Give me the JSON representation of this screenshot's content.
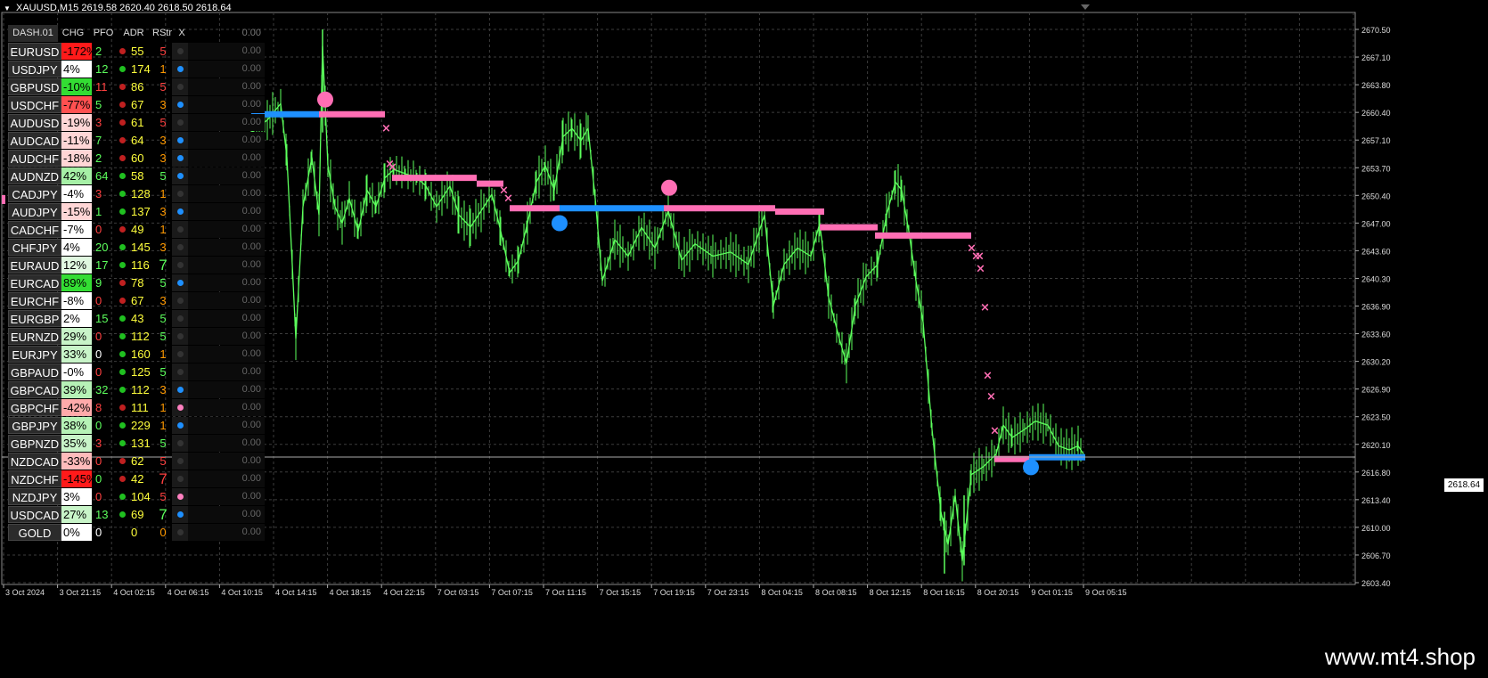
{
  "chart": {
    "symbol_title": "XAUUSD,M15",
    "ohlc": "2619.58 2620.40 2618.50 2618.64",
    "current_price": "2618.64",
    "price_labels": [
      "2670.50",
      "2667.10",
      "2663.80",
      "2660.40",
      "2657.10",
      "2653.70",
      "2650.40",
      "2647.00",
      "2643.60",
      "2640.30",
      "2636.90",
      "2633.60",
      "2630.20",
      "2626.90",
      "2623.50",
      "2620.10",
      "2616.80",
      "2613.40",
      "2610.00",
      "2606.70",
      "2603.40"
    ],
    "time_labels": [
      "3 Oct 2024",
      "3 Oct 21:15",
      "4 Oct 02:15",
      "4 Oct 06:15",
      "4 Oct 10:15",
      "4 Oct 14:15",
      "4 Oct 18:15",
      "4 Oct 22:15",
      "7 Oct 03:15",
      "7 Oct 07:15",
      "7 Oct 11:15",
      "7 Oct 15:15",
      "7 Oct 19:15",
      "7 Oct 23:15",
      "8 Oct 04:15",
      "8 Oct 08:15",
      "8 Oct 12:15",
      "8 Oct 16:15",
      "8 Oct 20:15",
      "9 Oct 01:15",
      "9 Oct 05:15"
    ],
    "colors": {
      "candle": "#5cff5c",
      "grid": "#3c3c3c",
      "pink": "#ff6eb4",
      "blue": "#1e90ff"
    }
  },
  "dashboard": {
    "title": "DASH.01",
    "headers": [
      "CHG",
      "PFO",
      "ADR",
      "RStr",
      "X"
    ],
    "header_value": "0.00",
    "rows": [
      {
        "name": "EURUSD",
        "chg": "-172%",
        "chg_bg": "#ff1a1a",
        "pfo": "2",
        "pfo_color": "#5cff5c",
        "dot": "#c02020",
        "adr": "55",
        "rstr": "5",
        "rstr_color": "#ff4040",
        "dot2": "#333333",
        "value": "0.00"
      },
      {
        "name": "USDJPY",
        "chg": "4%",
        "chg_bg": "#ffffff",
        "pfo": "12",
        "pfo_color": "#5cff5c",
        "dot": "#20c020",
        "adr": "174",
        "rstr": "1",
        "rstr_color": "#ff9900",
        "dot2": "#1e90ff",
        "value": "0.00"
      },
      {
        "name": "GBPUSD",
        "chg": "-10%",
        "chg_bg": "#33dd33",
        "pfo": "11",
        "pfo_color": "#ff4040",
        "dot": "#c02020",
        "adr": "86",
        "rstr": "5",
        "rstr_color": "#ff4040",
        "dot2": "#333333",
        "value": "0.00"
      },
      {
        "name": "USDCHF",
        "chg": "-77%",
        "chg_bg": "#ff5050",
        "pfo": "5",
        "pfo_color": "#5cff5c",
        "dot": "#c02020",
        "adr": "67",
        "rstr": "3",
        "rstr_color": "#ff9900",
        "dot2": "#1e90ff",
        "value": "0.00"
      },
      {
        "name": "AUDUSD",
        "chg": "-19%",
        "chg_bg": "#ffd6d6",
        "pfo": "3",
        "pfo_color": "#ff4040",
        "dot": "#c02020",
        "adr": "61",
        "rstr": "5",
        "rstr_color": "#ff4040",
        "dot2": "#333333",
        "value": "0.00"
      },
      {
        "name": "AUDCAD",
        "chg": "-11%",
        "chg_bg": "#ffd6d6",
        "pfo": "7",
        "pfo_color": "#5cff5c",
        "dot": "#c02020",
        "adr": "64",
        "rstr": "3",
        "rstr_color": "#ff9900",
        "dot2": "#1e90ff",
        "value": "0.00"
      },
      {
        "name": "AUDCHF",
        "chg": "-18%",
        "chg_bg": "#ffd6d6",
        "pfo": "2",
        "pfo_color": "#5cff5c",
        "dot": "#c02020",
        "adr": "60",
        "rstr": "3",
        "rstr_color": "#ff9900",
        "dot2": "#1e90ff",
        "value": "0.00"
      },
      {
        "name": "AUDNZD",
        "chg": "42%",
        "chg_bg": "#a6f0a6",
        "pfo": "64",
        "pfo_color": "#5cff5c",
        "dot": "#20c020",
        "adr": "58",
        "rstr": "5",
        "rstr_color": "#5cff5c",
        "dot2": "#1e90ff",
        "value": "0.00"
      },
      {
        "name": "CADJPY",
        "chg": "-4%",
        "chg_bg": "#ffffff",
        "pfo": "3",
        "pfo_color": "#ff4040",
        "dot": "#20c020",
        "adr": "128",
        "rstr": "1",
        "rstr_color": "#ff9900",
        "dot2": "#333333",
        "value": "0.00"
      },
      {
        "name": "AUDJPY",
        "chg": "-15%",
        "chg_bg": "#ffd6d6",
        "pfo": "1",
        "pfo_color": "#5cff5c",
        "dot": "#20c020",
        "adr": "137",
        "rstr": "3",
        "rstr_color": "#ff9900",
        "dot2": "#1e90ff",
        "value": "0.00"
      },
      {
        "name": "CADCHF",
        "chg": "-7%",
        "chg_bg": "#ffffff",
        "pfo": "0",
        "pfo_color": "#ff4040",
        "dot": "#c02020",
        "adr": "49",
        "rstr": "1",
        "rstr_color": "#ff9900",
        "dot2": "#333333",
        "value": "0.00"
      },
      {
        "name": "CHFJPY",
        "chg": "4%",
        "chg_bg": "#ffffff",
        "pfo": "20",
        "pfo_color": "#5cff5c",
        "dot": "#20c020",
        "adr": "145",
        "rstr": "3",
        "rstr_color": "#ff9900",
        "dot2": "#333333",
        "value": "0.00"
      },
      {
        "name": "EURAUD",
        "chg": "12%",
        "chg_bg": "#e0f8e0",
        "pfo": "17",
        "pfo_color": "#5cff5c",
        "dot": "#20c020",
        "adr": "116",
        "rstr": "7",
        "rstr_color": "#5cff5c",
        "dot2": "#333333",
        "value": "0.00"
      },
      {
        "name": "EURCAD",
        "chg": "89%",
        "chg_bg": "#33dd33",
        "pfo": "9",
        "pfo_color": "#5cff5c",
        "dot": "#c02020",
        "adr": "78",
        "rstr": "5",
        "rstr_color": "#5cff5c",
        "dot2": "#1e90ff",
        "value": "0.00"
      },
      {
        "name": "EURCHF",
        "chg": "-8%",
        "chg_bg": "#ffffff",
        "pfo": "0",
        "pfo_color": "#ff4040",
        "dot": "#c02020",
        "adr": "67",
        "rstr": "3",
        "rstr_color": "#ff9900",
        "dot2": "#333333",
        "value": "0.00"
      },
      {
        "name": "EURGBP",
        "chg": "2%",
        "chg_bg": "#ffffff",
        "pfo": "15",
        "pfo_color": "#5cff5c",
        "dot": "#20c020",
        "adr": "43",
        "rstr": "5",
        "rstr_color": "#5cff5c",
        "dot2": "#333333",
        "value": "0.00"
      },
      {
        "name": "EURNZD",
        "chg": "29%",
        "chg_bg": "#c8f4c8",
        "pfo": "0",
        "pfo_color": "#ff4040",
        "dot": "#20c020",
        "adr": "112",
        "rstr": "5",
        "rstr_color": "#5cff5c",
        "dot2": "#333333",
        "value": "0.00"
      },
      {
        "name": "EURJPY",
        "chg": "33%",
        "chg_bg": "#c8f4c8",
        "pfo": "0",
        "pfo_color": "#ffffff",
        "dot": "#20c020",
        "adr": "160",
        "rstr": "1",
        "rstr_color": "#ff9900",
        "dot2": "#333333",
        "value": "0.00"
      },
      {
        "name": "GBPAUD",
        "chg": "-0%",
        "chg_bg": "#ffffff",
        "pfo": "0",
        "pfo_color": "#ff4040",
        "dot": "#20c020",
        "adr": "125",
        "rstr": "5",
        "rstr_color": "#5cff5c",
        "dot2": "#333333",
        "value": "0.00"
      },
      {
        "name": "GBPCAD",
        "chg": "39%",
        "chg_bg": "#b6f2b6",
        "pfo": "32",
        "pfo_color": "#5cff5c",
        "dot": "#20c020",
        "adr": "112",
        "rstr": "3",
        "rstr_color": "#ff9900",
        "dot2": "#1e90ff",
        "value": "0.00"
      },
      {
        "name": "GBPCHF",
        "chg": "-42%",
        "chg_bg": "#ffaaaa",
        "pfo": "8",
        "pfo_color": "#ff4040",
        "dot": "#c02020",
        "adr": "111",
        "rstr": "1",
        "rstr_color": "#ff9900",
        "dot2": "#ff80c0",
        "value": "0.00"
      },
      {
        "name": "GBPJPY",
        "chg": "38%",
        "chg_bg": "#b6f2b6",
        "pfo": "0",
        "pfo_color": "#5cff5c",
        "dot": "#20c020",
        "adr": "229",
        "rstr": "1",
        "rstr_color": "#ff9900",
        "dot2": "#1e90ff",
        "value": "0.00"
      },
      {
        "name": "GBPNZD",
        "chg": "35%",
        "chg_bg": "#c8f4c8",
        "pfo": "3",
        "pfo_color": "#ff4040",
        "dot": "#20c020",
        "adr": "131",
        "rstr": "5",
        "rstr_color": "#5cff5c",
        "dot2": "#333333",
        "value": "0.00"
      },
      {
        "name": "NZDCAD",
        "chg": "-33%",
        "chg_bg": "#ffbbbb",
        "pfo": "0",
        "pfo_color": "#ff4040",
        "dot": "#c02020",
        "adr": "62",
        "rstr": "5",
        "rstr_color": "#ff4040",
        "dot2": "#333333",
        "value": "0.00"
      },
      {
        "name": "NZDCHF",
        "chg": "-145%",
        "chg_bg": "#ff1a1a",
        "pfo": "0",
        "pfo_color": "#5cff5c",
        "dot": "#c02020",
        "adr": "42",
        "rstr": "7",
        "rstr_color": "#ff4040",
        "dot2": "#333333",
        "value": "0.00"
      },
      {
        "name": "NZDJPY",
        "chg": "3%",
        "chg_bg": "#ffffff",
        "pfo": "0",
        "pfo_color": "#ff4040",
        "dot": "#20c020",
        "adr": "104",
        "rstr": "5",
        "rstr_color": "#ff4040",
        "dot2": "#ff80c0",
        "value": "0.00"
      },
      {
        "name": "USDCAD",
        "chg": "27%",
        "chg_bg": "#c8f4c8",
        "pfo": "13",
        "pfo_color": "#5cff5c",
        "dot": "#20c020",
        "adr": "69",
        "rstr": "7",
        "rstr_color": "#5cff5c",
        "dot2": "#1e90ff",
        "value": "0.00"
      },
      {
        "name": "GOLD",
        "chg": "0%",
        "chg_bg": "#ffffff",
        "pfo": "0",
        "pfo_color": "#ffffff",
        "dot": "#000000",
        "adr": "0",
        "rstr": "0",
        "rstr_color": "#ff9900",
        "dot2": "#333333",
        "value": "0.00"
      }
    ]
  },
  "watermark": "www.mt4.shop"
}
